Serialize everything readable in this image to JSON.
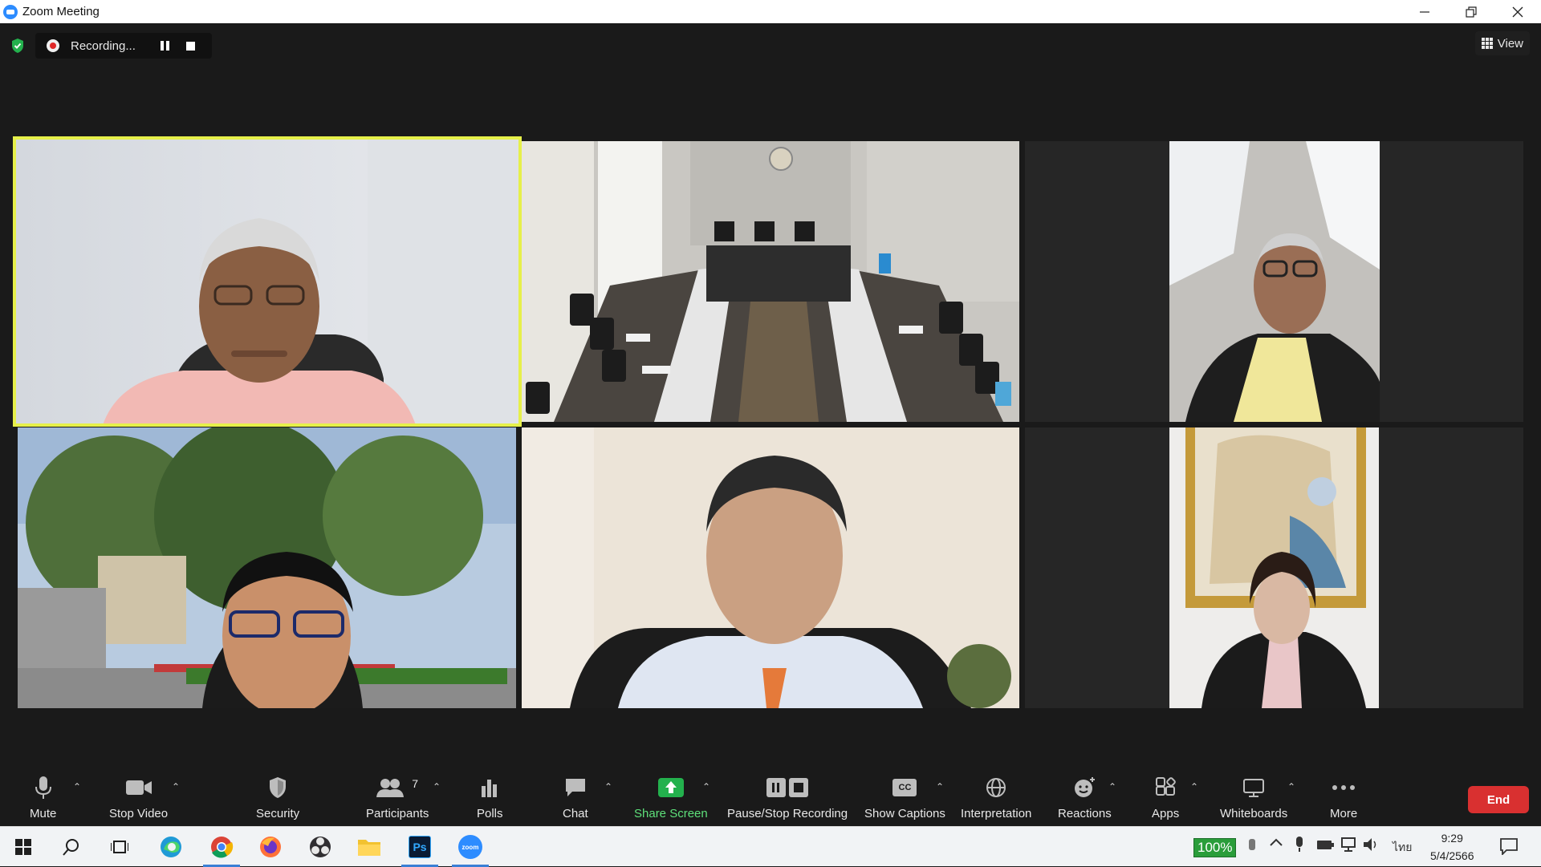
{
  "window": {
    "title": "Zoom Meeting",
    "controls": [
      "minimize",
      "restore",
      "close"
    ]
  },
  "meeting": {
    "recording_status": "Recording...",
    "view_label": "View"
  },
  "tiles": [
    {
      "name": "participant-1",
      "active_speaker": true
    },
    {
      "name": "participant-2-meeting-room",
      "active_speaker": false
    },
    {
      "name": "participant-3",
      "active_speaker": false
    },
    {
      "name": "participant-4",
      "active_speaker": false
    },
    {
      "name": "participant-5",
      "active_speaker": false
    },
    {
      "name": "participant-6",
      "active_speaker": false
    }
  ],
  "toolbar": {
    "mute": "Mute",
    "stop_video": "Stop Video",
    "security": "Security",
    "participants": "Participants",
    "participants_count": "7",
    "polls": "Polls",
    "chat": "Chat",
    "share_screen": "Share Screen",
    "pause_stop_recording": "Pause/Stop Recording",
    "show_captions": "Show Captions",
    "captions_icon_text": "CC",
    "interpretation": "Interpretation",
    "reactions": "Reactions",
    "apps": "Apps",
    "whiteboards": "Whiteboards",
    "more": "More",
    "end": "End"
  },
  "taskbar": {
    "battery": "100%",
    "language": "ไทย",
    "time": "9:29",
    "date": "5/4/2566",
    "apps": [
      "windows-start",
      "search",
      "task-view",
      "edge",
      "chrome",
      "firefox",
      "obs",
      "file-explorer",
      "photoshop",
      "zoom"
    ],
    "photoshop_label": "Ps",
    "zoom_label": "zoom"
  },
  "colors": {
    "active_speaker_border": "#e6f04a",
    "share_screen_green": "#5ee07a",
    "end_red": "#d93030",
    "background": "#1a1a1a"
  }
}
